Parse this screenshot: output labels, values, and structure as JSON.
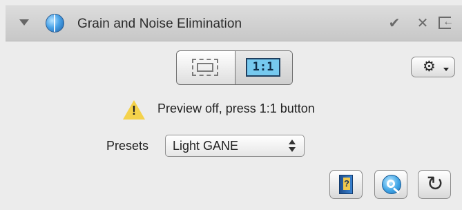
{
  "header": {
    "title": "Grain and Noise Elimination",
    "icons": {
      "disclosure": "disclosure-triangle-icon",
      "app": "globe-icon",
      "confirm": "check-icon",
      "close": "close-icon",
      "exit": "exit-icon"
    }
  },
  "preview": {
    "toggle_left_icon": "frame-dashed-icon",
    "toggle_right_label": "1:1",
    "status_text": "Preview off, press 1:1 button",
    "warning_icon": "warning-icon"
  },
  "settings": {
    "icon": "gear-icon",
    "caret_icon": "chevron-down-icon"
  },
  "presets": {
    "label": "Presets",
    "selected": "Light GANE",
    "icon": "updown-icon"
  },
  "bottom_buttons": {
    "help_icon": "help-book-icon",
    "zoom_icon": "zoom-icon",
    "reset_icon": "reset-icon"
  },
  "colors": {
    "header_bg": "#d0d0d0",
    "panel_bg": "#ececec",
    "accent_blue": "#76c9ef",
    "warning_yellow": "#f4d24b"
  }
}
